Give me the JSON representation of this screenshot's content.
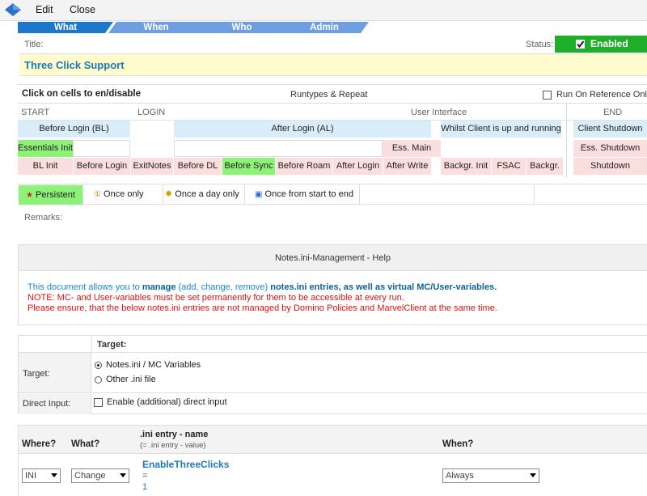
{
  "menubar": {
    "edit": "Edit",
    "close": "Close"
  },
  "tabs": [
    "What",
    "When",
    "Who",
    "Admin"
  ],
  "title_label": "Title:",
  "title_value": "Three Click Support",
  "status_label": "Status:",
  "status_value": "Enabled",
  "runtypes": {
    "header": "Click on cells to en/disable",
    "center": "Runtypes & Repeat",
    "run_on_reference": "Run On Reference Only",
    "start": "START",
    "login": "LOGIN",
    "user_interface": "User Interface",
    "end": "END",
    "before_login_bl": "Before Login (BL)",
    "after_login_al": "After Login (AL)",
    "whilst_client": "Whilst Client is up and running",
    "client_shutdown": "Client Shutdown",
    "essentials_init": "Essentials Init",
    "ess_main": "Ess. Main",
    "ess_shutdown": "Ess. Shutdown",
    "row3": [
      "BL Init",
      "Before Login",
      "ExitNotes",
      "Before DL",
      "Before Sync",
      "Before Roam",
      "After Login",
      "After Write",
      "Backgr. Init",
      "FSAC",
      "Backgr.",
      "Shutdown"
    ]
  },
  "repeat": {
    "persistent": "Persistent",
    "once_only": "Once only",
    "once_day": "Once a day only",
    "once_start_end": "Once from start to end"
  },
  "remarks_label": "Remarks:",
  "help": {
    "title": "Notes.ini-Management - Help",
    "line1_a": "This document allows you to ",
    "line1_b": "manage",
    "line1_c": " (add, change, remove) ",
    "line1_d": "notes.ini entries, as well as virtual MC/User-variables.",
    "line2": "NOTE: MC- and User-variables must be set permanently for them to be accessible at every run.",
    "line3": "Please ensure, that the below notes.ini entries are not managed by Domino Policies and MarvelClient at the same time."
  },
  "target": {
    "header": "Target:",
    "label": "Target:",
    "opt1": "Notes.ini / MC Variables",
    "opt2": "Other .ini file",
    "direct_label": "Direct Input:",
    "direct_opt": "Enable (additional) direct input"
  },
  "entries": {
    "col_where": "Where?",
    "col_what": "What?",
    "col_name": ".ini entry - name",
    "col_name_sub": "(= .ini entry - value)",
    "col_when": "When?",
    "where_value": "INI",
    "what_value": "Change",
    "entry_name": "EnableThreeClicks",
    "equals": "=",
    "entry_value": "1",
    "when_value": "Always"
  },
  "colors": {
    "accent_blue": "#1b7bb5",
    "tab_blue": "#6f9fe0",
    "enabled_green": "#1fae2a",
    "cell_green": "#8ff278",
    "cell_blue": "#d8ecfa",
    "cell_pink": "#fbdede",
    "title_yellow": "#fffbcc"
  }
}
